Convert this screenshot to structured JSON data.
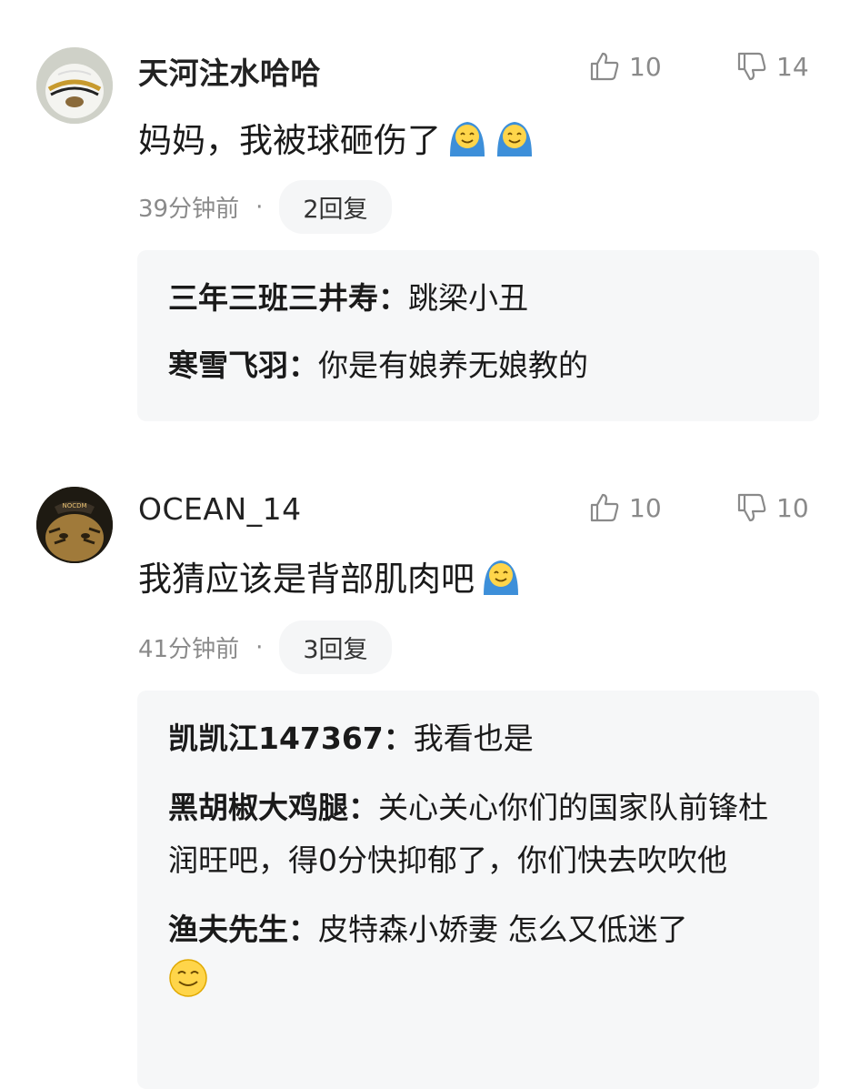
{
  "comments": [
    {
      "username": "天河注水哈哈",
      "likes": "10",
      "dislikes": "14",
      "text": "妈妈，我被球砸伤了",
      "time": "39分钟前",
      "separator": "·",
      "replies_label": "2回复",
      "emoji": "blanket-smile-emoji",
      "replies": [
        {
          "name": "三年三班三井寿：",
          "text": "跳梁小丑"
        },
        {
          "name": "寒雪飞羽：",
          "text": "你是有娘养无娘教的"
        }
      ]
    },
    {
      "username": "OCEAN_14",
      "likes": "10",
      "dislikes": "10",
      "text": "我猜应该是背部肌肉吧",
      "time": "41分钟前",
      "separator": "·",
      "replies_label": "3回复",
      "emoji": "blanket-smile-emoji",
      "replies": [
        {
          "name": "凯凯江147367：",
          "text": "我看也是"
        },
        {
          "name": "黑胡椒大鸡腿：",
          "text": "关心关心你们的国家队前锋杜润旺吧，得0分快抑郁了，你们快去吹吹他"
        },
        {
          "name": "渔夫先生：",
          "text": "皮特森小娇妻 怎么又低迷了"
        }
      ]
    }
  ],
  "colors": {
    "username": "#222222",
    "meta": "#8a8a8a",
    "reply_box_bg": "#f6f7f8",
    "reply_button_bg": "#f5f6f7"
  }
}
